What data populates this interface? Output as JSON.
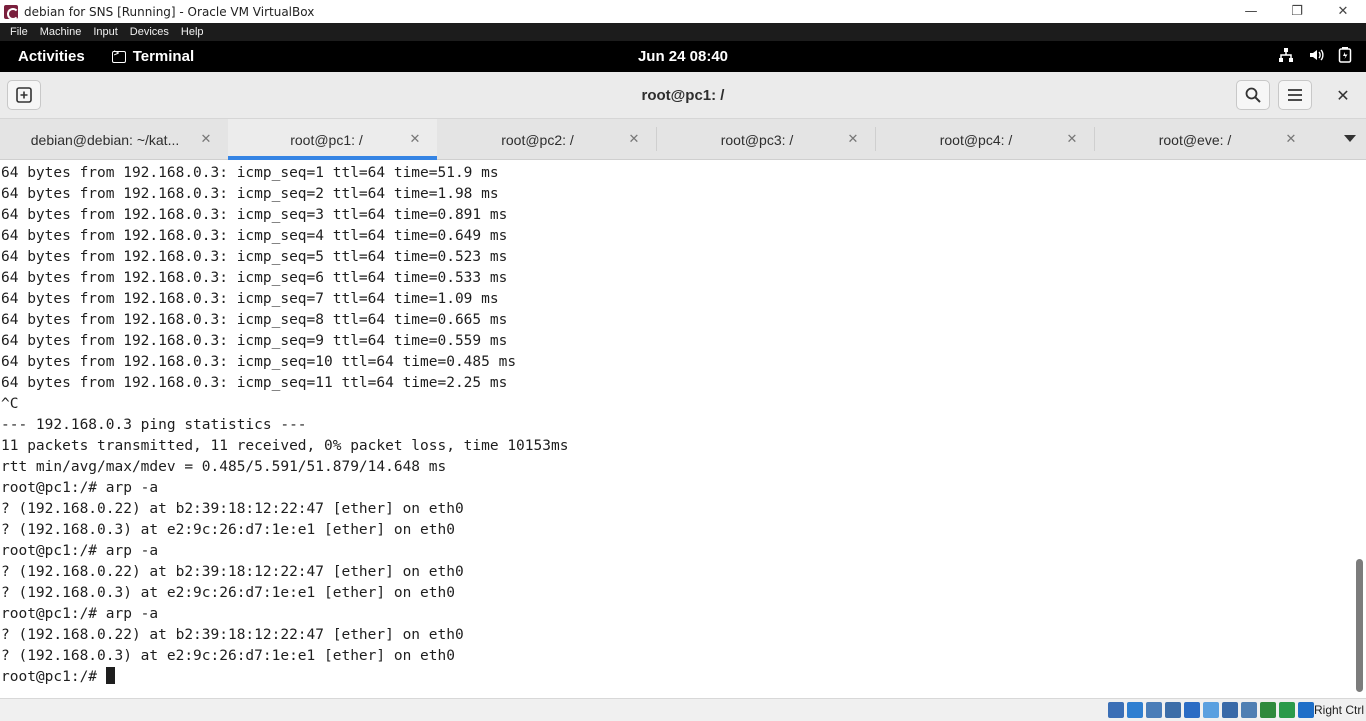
{
  "window": {
    "title": "debian for SNS [Running] - Oracle VM VirtualBox",
    "controls": {
      "minimize": "—",
      "restore": "❐",
      "close": "✕"
    }
  },
  "host_menu": [
    "File",
    "Machine",
    "Input",
    "Devices",
    "Help"
  ],
  "gnome": {
    "activities": "Activities",
    "app_name": "Terminal",
    "clock": "Jun 24  08:40",
    "tray_icons": [
      "network-icon",
      "volume-icon",
      "battery-icon"
    ]
  },
  "terminal_header": {
    "title": "root@pc1: /",
    "close_glyph": "✕"
  },
  "tabs": [
    {
      "label": "debian@debian: ~/kat...",
      "close": "✕",
      "active": false
    },
    {
      "label": "root@pc1: /",
      "close": "✕",
      "active": true
    },
    {
      "label": "root@pc2: /",
      "close": "✕",
      "active": false
    },
    {
      "label": "root@pc3: /",
      "close": "✕",
      "active": false
    },
    {
      "label": "root@pc4: /",
      "close": "✕",
      "active": false
    },
    {
      "label": "root@eve: /",
      "close": "✕",
      "active": false
    }
  ],
  "terminal_lines": [
    "64 bytes from 192.168.0.3: icmp_seq=1 ttl=64 time=51.9 ms",
    "64 bytes from 192.168.0.3: icmp_seq=2 ttl=64 time=1.98 ms",
    "64 bytes from 192.168.0.3: icmp_seq=3 ttl=64 time=0.891 ms",
    "64 bytes from 192.168.0.3: icmp_seq=4 ttl=64 time=0.649 ms",
    "64 bytes from 192.168.0.3: icmp_seq=5 ttl=64 time=0.523 ms",
    "64 bytes from 192.168.0.3: icmp_seq=6 ttl=64 time=0.533 ms",
    "64 bytes from 192.168.0.3: icmp_seq=7 ttl=64 time=1.09 ms",
    "64 bytes from 192.168.0.3: icmp_seq=8 ttl=64 time=0.665 ms",
    "64 bytes from 192.168.0.3: icmp_seq=9 ttl=64 time=0.559 ms",
    "64 bytes from 192.168.0.3: icmp_seq=10 ttl=64 time=0.485 ms",
    "64 bytes from 192.168.0.3: icmp_seq=11 ttl=64 time=2.25 ms",
    "^C",
    "--- 192.168.0.3 ping statistics ---",
    "11 packets transmitted, 11 received, 0% packet loss, time 10153ms",
    "rtt min/avg/max/mdev = 0.485/5.591/51.879/14.648 ms",
    "root@pc1:/# arp -a",
    "? (192.168.0.22) at b2:39:18:12:22:47 [ether] on eth0",
    "? (192.168.0.3) at e2:9c:26:d7:1e:e1 [ether] on eth0",
    "root@pc1:/# arp -a",
    "? (192.168.0.22) at b2:39:18:12:22:47 [ether] on eth0",
    "? (192.168.0.3) at e2:9c:26:d7:1e:e1 [ether] on eth0",
    "root@pc1:/# arp -a",
    "? (192.168.0.22) at b2:39:18:12:22:47 [ether] on eth0",
    "? (192.168.0.3) at e2:9c:26:d7:1e:e1 [ether] on eth0"
  ],
  "prompt": "root@pc1:/# ",
  "status_bar": {
    "host_key": "Right Ctrl",
    "icons": [
      {
        "name": "hard-disk-icon",
        "color": "#3b6fb6"
      },
      {
        "name": "optical-drive-icon",
        "color": "#2f7fd1"
      },
      {
        "name": "audio-icon",
        "color": "#4a7db8"
      },
      {
        "name": "network-icon",
        "color": "#3d6ea8"
      },
      {
        "name": "usb-icon",
        "color": "#2b6cc4"
      },
      {
        "name": "shared-folders-icon",
        "color": "#5aa0e0"
      },
      {
        "name": "display-icon",
        "color": "#3a6aa8"
      },
      {
        "name": "recording-icon",
        "color": "#4f7fb3"
      },
      {
        "name": "cpu-icon",
        "color": "#2f8a3d"
      },
      {
        "name": "mouse-integration-icon",
        "color": "#2a9a4a"
      },
      {
        "name": "keyboard-capture-icon",
        "color": "#1f6fc8"
      }
    ]
  }
}
